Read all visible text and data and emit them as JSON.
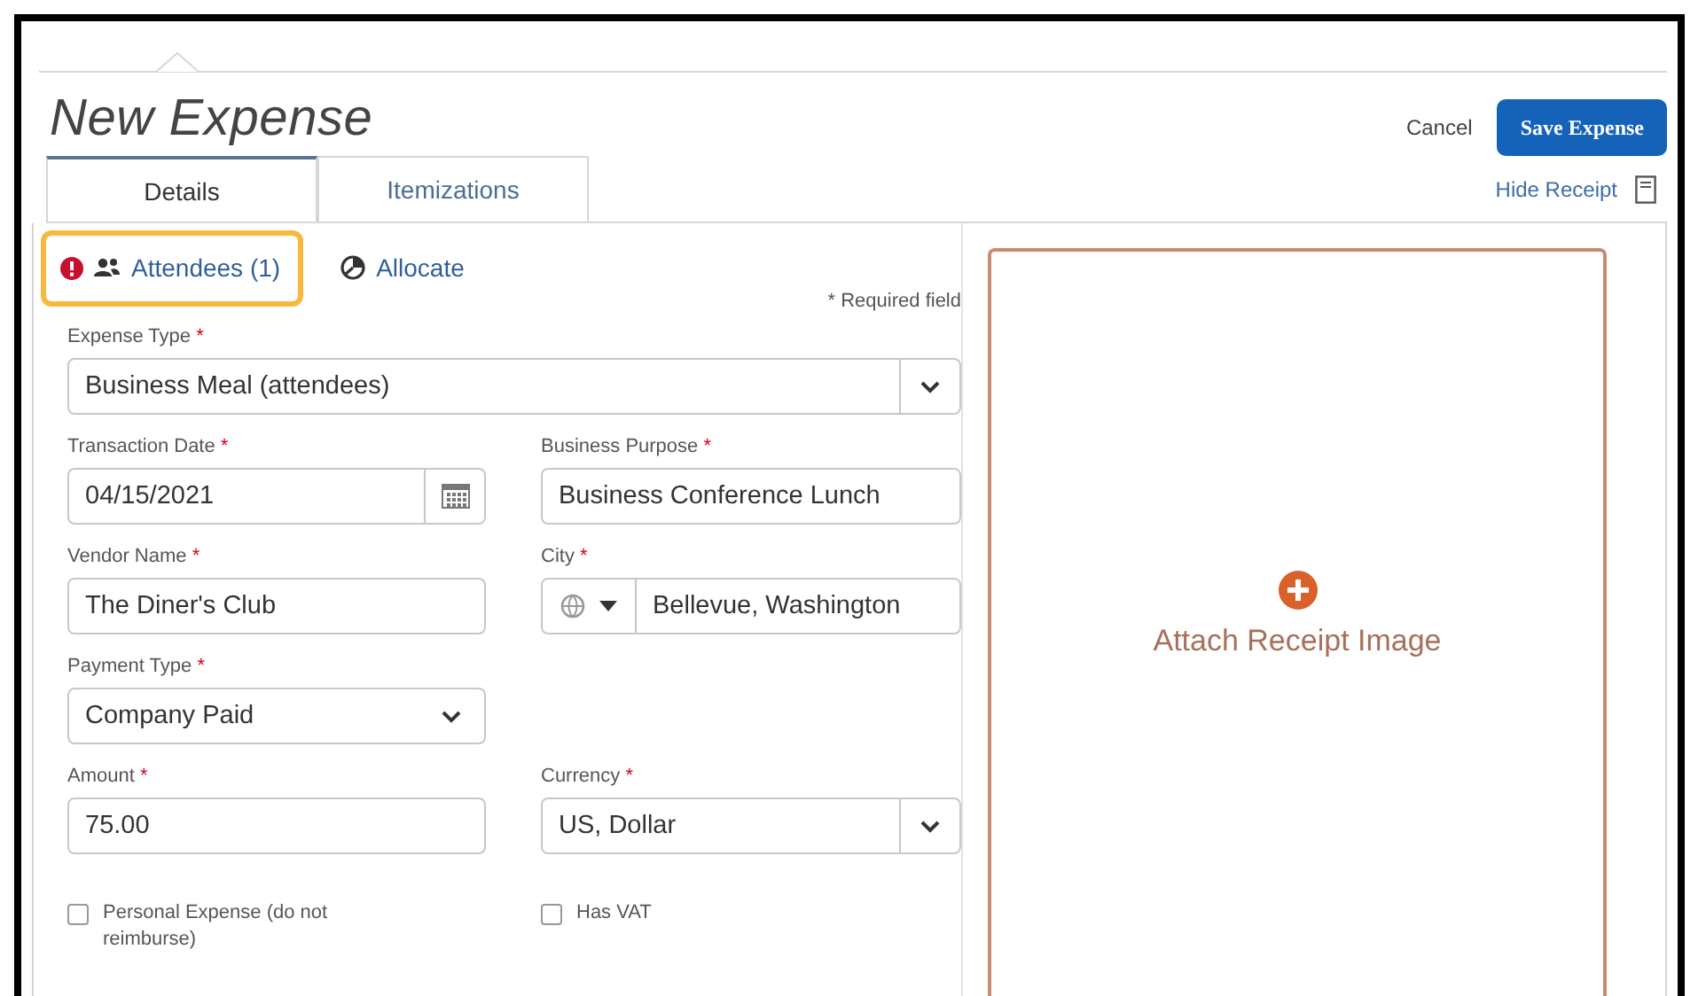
{
  "title": "New Expense",
  "actions": {
    "cancel": "Cancel",
    "save": "Save Expense"
  },
  "tabs": [
    {
      "label": "Details",
      "selected": true
    },
    {
      "label": "Itemizations",
      "selected": false
    }
  ],
  "hide_receipt": "Hide Receipt",
  "links": [
    {
      "kind": "attendees",
      "label": "Attendees (1)",
      "warning": true,
      "highlighted": true
    },
    {
      "kind": "allocate",
      "label": "Allocate",
      "warning": false,
      "highlighted": false
    }
  ],
  "required_note": "* Required field",
  "rows": [
    [
      {
        "kind": "combo",
        "label": "Expense Type",
        "mark": "*",
        "value": "Business Meal (attendees)"
      }
    ],
    [
      {
        "kind": "date",
        "label": "Transaction Date",
        "mark": "*",
        "value": "04/15/2021"
      },
      {
        "kind": "text",
        "label": "Business Purpose",
        "mark": "*",
        "value": "Business Conference Lunch"
      }
    ],
    [
      {
        "kind": "text",
        "label": "Vendor Name",
        "mark": "*",
        "value": "The Diner's Club"
      },
      {
        "kind": "city",
        "label": "City",
        "mark": "*",
        "value": "Bellevue, Washington"
      }
    ],
    [
      {
        "kind": "select",
        "label": "Payment Type",
        "mark": "*",
        "value": "Company Paid"
      }
    ],
    [
      {
        "kind": "text",
        "label": "Amount",
        "mark": "*",
        "value": "75.00"
      },
      {
        "kind": "combo",
        "label": "Currency",
        "mark": "*",
        "value": "US, Dollar"
      }
    ]
  ],
  "checkboxes": [
    {
      "label": "Personal Expense (do not reimburse)",
      "checked": false
    },
    {
      "label": "Has VAT",
      "checked": false
    }
  ],
  "receipt": {
    "label": "Attach Receipt Image"
  }
}
